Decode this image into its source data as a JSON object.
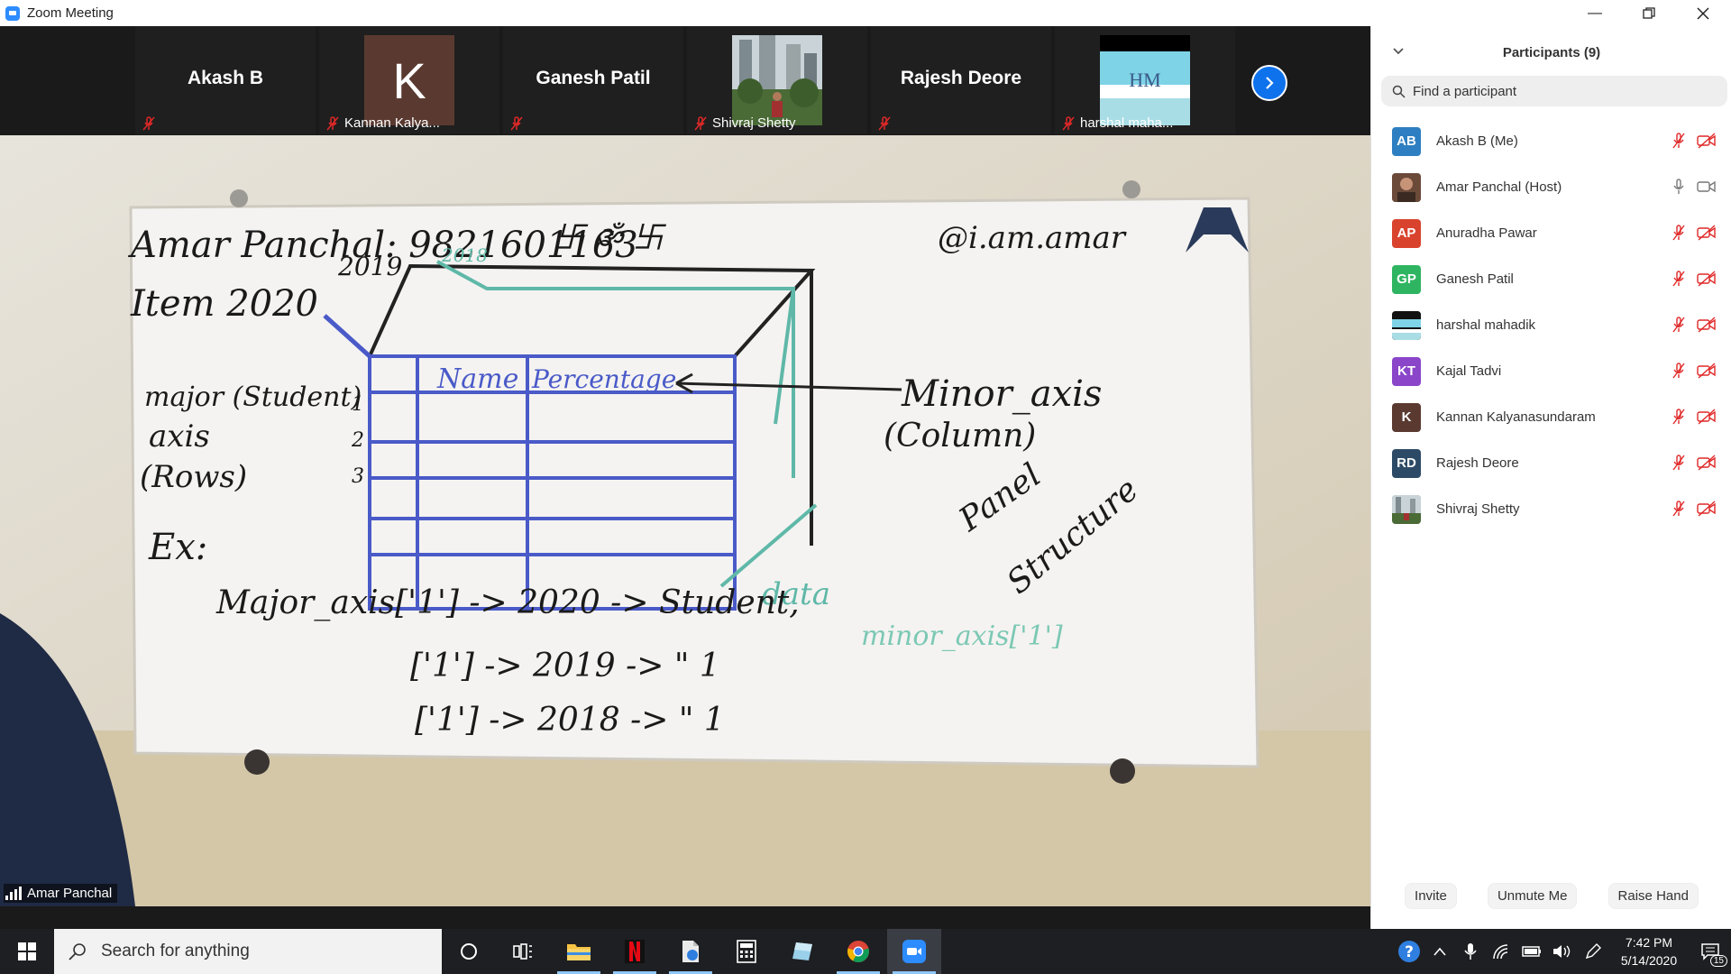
{
  "window": {
    "title": "Zoom Meeting"
  },
  "thumbnails": [
    {
      "display": "Akash B",
      "label": ""
    },
    {
      "display": "K",
      "label": "Kannan Kalya..."
    },
    {
      "display": "Ganesh Patil",
      "label": ""
    },
    {
      "display": "",
      "label": "Shivraj Shetty"
    },
    {
      "display": "Rajesh Deore",
      "label": ""
    },
    {
      "display": "HM",
      "label": "harshal maha..."
    }
  ],
  "video": {
    "speaker_label": "Amar Panchal"
  },
  "whiteboard": {
    "lines": [
      "Amar Panchal: 9821601163",
      "卐 ॐ 卐",
      "@i.am.amar",
      "2019",
      "Item 2020",
      "2018",
      "Name",
      "Percentage",
      "Minor_axis",
      "(Column)",
      "major (Student)",
      "axis",
      "(Rows)",
      "1",
      "2",
      "3",
      "Panel",
      "Structure",
      "data",
      "Ex:",
      "Major_axis['1'] -> 2020 -> Student,",
      "['1'] -> 2019 -> \" 1",
      "['1'] -> 2018 -> \" 1",
      "minor_axis['1']"
    ]
  },
  "panel": {
    "title": "Participants (9)",
    "search_placeholder": "Find a participant",
    "participants": [
      {
        "initials": "AB",
        "name": "Akash B (Me)",
        "color": "#2d7fc1",
        "audio": "muted",
        "video": "off"
      },
      {
        "initials": "",
        "name": "Amar Panchal (Host)",
        "color": "#6b4a3a",
        "audio": "on",
        "video": "on"
      },
      {
        "initials": "AP",
        "name": "Anuradha Pawar",
        "color": "#d9432e",
        "audio": "muted",
        "video": "off"
      },
      {
        "initials": "GP",
        "name": "Ganesh Patil",
        "color": "#2fb561",
        "audio": "muted",
        "video": "off"
      },
      {
        "initials": "",
        "name": "harshal mahadik",
        "color": "#1c2733",
        "audio": "muted",
        "video": "off"
      },
      {
        "initials": "KT",
        "name": "Kajal Tadvi",
        "color": "#8a45c9",
        "audio": "muted",
        "video": "off"
      },
      {
        "initials": "K",
        "name": "Kannan Kalyanasundaram",
        "color": "#5a3a30",
        "audio": "muted",
        "video": "off"
      },
      {
        "initials": "RD",
        "name": "Rajesh Deore",
        "color": "#2c4a66",
        "audio": "muted",
        "video": "off"
      },
      {
        "initials": "",
        "name": "Shivraj Shetty",
        "color": "#5d7a46",
        "audio": "muted",
        "video": "off"
      }
    ],
    "buttons": {
      "invite": "Invite",
      "unmute": "Unmute Me",
      "raise_hand": "Raise Hand"
    }
  },
  "taskbar": {
    "search_placeholder": "Search for anything",
    "time": "7:42 PM",
    "date": "5/14/2020",
    "notification_count": "15"
  },
  "colors": {
    "zoom_blue": "#0e72ed",
    "mute_red": "#e02828"
  }
}
